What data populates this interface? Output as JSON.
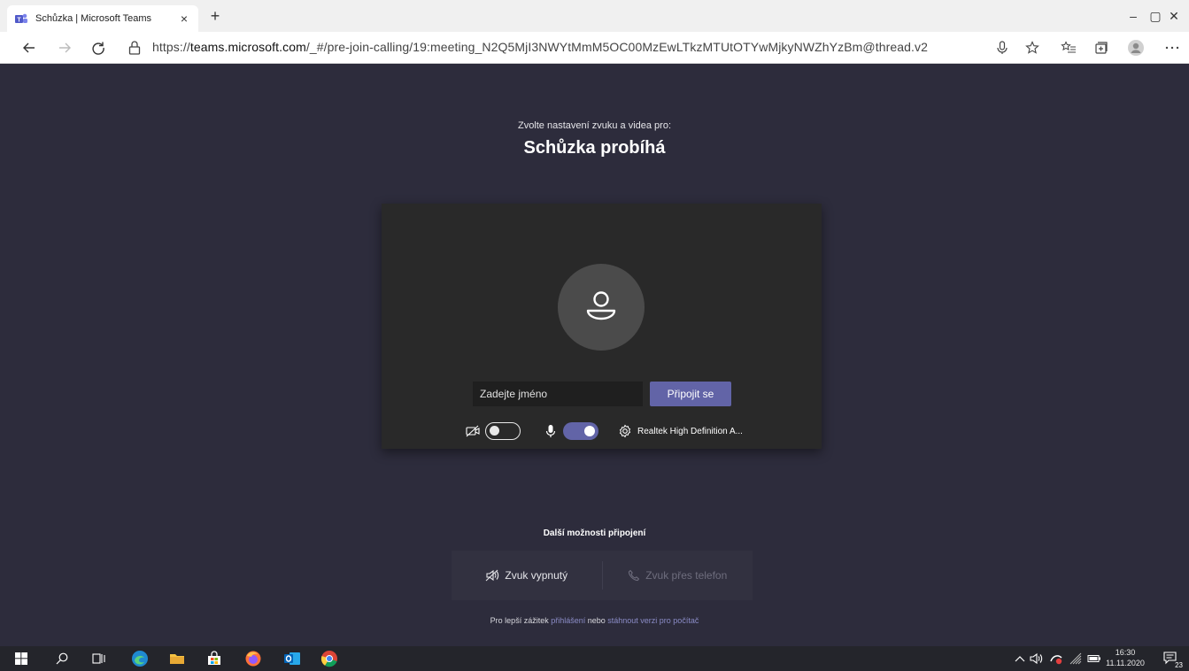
{
  "browser": {
    "tab_title": "Schůzka | Microsoft Teams",
    "tab_close": "×",
    "new_tab": "+",
    "url_prefix": "https://",
    "url_host": "teams.microsoft.com",
    "url_path": "/_#/pre-join-calling/19:meeting_N2Q5MjI3NWYtMmM5OC00MzEwLTkzMTUtOTYwMjkyNWZhYzBm@thread.v2",
    "minimize": "–",
    "maximize": "▢",
    "close": "✕"
  },
  "prejoin": {
    "subtitle": "Zvolte nastavení zvuku a videa pro:",
    "title": "Schůzka probíhá",
    "name_placeholder": "Zadejte jméno",
    "join_label": "Připojit se",
    "camera_on": false,
    "mic_on": true,
    "audio_device": "Realtek High Definition A..."
  },
  "more_options": {
    "heading": "Další možnosti připojení",
    "audio_off": "Zvuk vypnutý",
    "phone_audio": "Zvuk přes telefon"
  },
  "hint": {
    "prefix": "Pro lepší zážitek ",
    "login_link": "přihlášení",
    "middle": " nebo ",
    "download_link": "stáhnout verzi pro počítač"
  },
  "taskbar": {
    "time": "16:30",
    "date": "11.11.2020",
    "notification_count": "23"
  },
  "colors": {
    "page_bg": "#2d2c3c",
    "card_bg": "#292929",
    "accent": "#6264a7"
  }
}
